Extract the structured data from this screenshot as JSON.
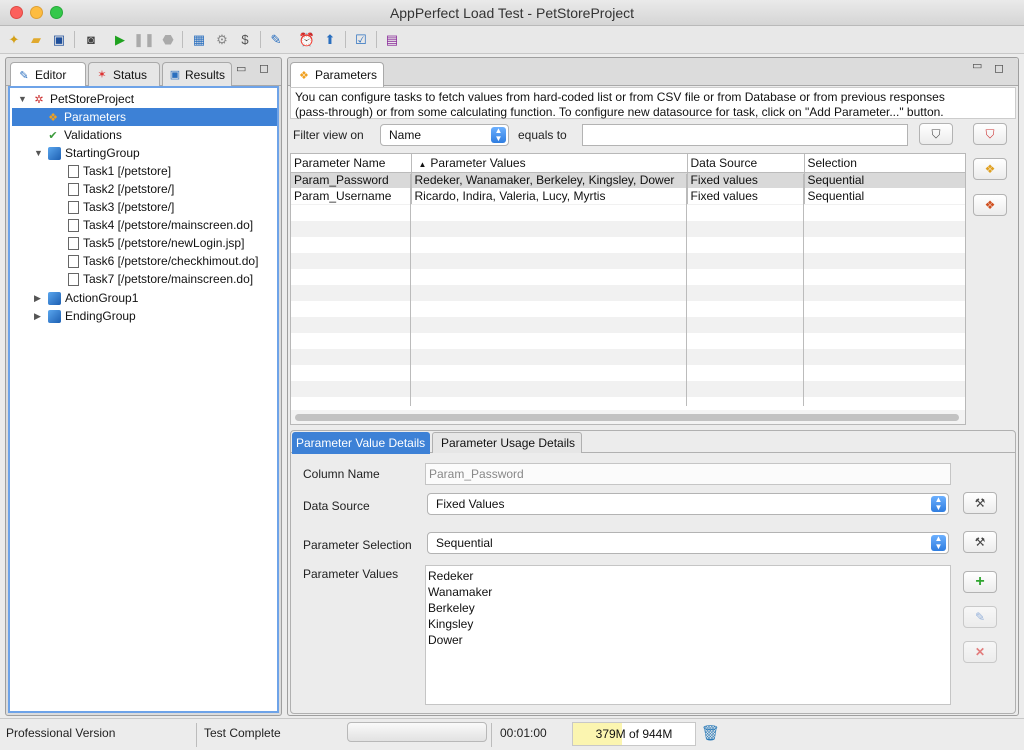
{
  "window": {
    "title": "AppPerfect Load Test - PetStoreProject"
  },
  "toolbar": {
    "icons": [
      "new-icon",
      "open-folder-icon",
      "save-icon",
      "record-icon",
      "play-icon",
      "pause-icon",
      "stop-icon",
      "monitor-icon",
      "agents-icon",
      "refresh-icon",
      "edit-icon",
      "schedule-icon",
      "export-icon",
      "checklist-icon",
      "help-book-icon"
    ]
  },
  "left_tabs": {
    "editor": "Editor",
    "status": "Status",
    "results": "Results"
  },
  "tree": {
    "project": "PetStoreProject",
    "parameters": "Parameters",
    "validations": "Validations",
    "starting_group": "StartingGroup",
    "tasks": [
      "Task1 [/petstore]",
      "Task2 [/petstore/]",
      "Task3 [/petstore/]",
      "Task4 [/petstore/mainscreen.do]",
      "Task5 [/petstore/newLogin.jsp]",
      "Task6 [/petstore/checkhimout.do]",
      "Task7 [/petstore/mainscreen.do]"
    ],
    "action_group": "ActionGroup1",
    "ending_group": "EndingGroup"
  },
  "right_tab": "Parameters",
  "info_line1": "You can configure tasks to fetch values from hard-coded list or from CSV file or from Database or from previous responses",
  "info_line2": "(pass-through) or from some calculating function. To configure new datasource for task, click on \"Add Parameter...\" button.",
  "filter": {
    "label": "Filter view on",
    "field": "Name",
    "equals_label": "equals to",
    "value": ""
  },
  "table": {
    "headers": {
      "name": "Parameter Name",
      "values": "Parameter Values",
      "source": "Data Source",
      "selection": "Selection"
    },
    "rows": [
      {
        "name": "Param_Password",
        "values": "Redeker, Wanamaker, Berkeley, Kingsley, Dower",
        "source": "Fixed values",
        "selection": "Sequential"
      },
      {
        "name": "Param_Username",
        "values": "Ricardo, Indira, Valeria, Lucy, Myrtis",
        "source": "Fixed values",
        "selection": "Sequential"
      }
    ]
  },
  "details_tabs": {
    "value_details": "Parameter Value Details",
    "usage_details": "Parameter Usage Details"
  },
  "details": {
    "column_name_label": "Column Name",
    "column_name_value": "Param_Password",
    "data_source_label": "Data Source",
    "data_source_value": "Fixed Values",
    "selection_label": "Parameter Selection",
    "selection_value": "Sequential",
    "values_label": "Parameter Values",
    "values": [
      "Redeker",
      "Wanamaker",
      "Berkeley",
      "Kingsley",
      "Dower"
    ]
  },
  "status": {
    "edition": "Professional Version",
    "state": "Test Complete",
    "elapsed": "00:01:00",
    "memory": "379M of 944M",
    "memory_fraction": 0.4
  },
  "colors": {
    "selection": "#3d81d6",
    "accent": "#2f7de0"
  }
}
